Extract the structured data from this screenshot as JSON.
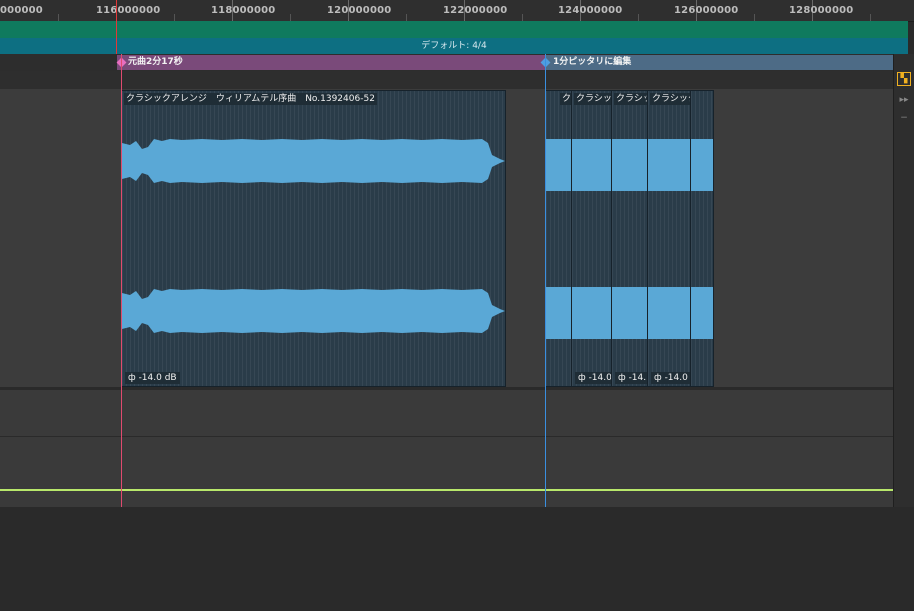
{
  "ruler": {
    "labels": [
      "000000",
      "116000000",
      "118000000",
      "120000000",
      "122000000",
      "124000000",
      "126000000",
      "128000000"
    ]
  },
  "tempo_lane": {
    "time_signature": "デフォルト: 4/4"
  },
  "markers": [
    {
      "label": "元曲2分17秒",
      "color": "#e86ec0"
    },
    {
      "label": "1分ピッタリに編集",
      "color": "#4f9ee0"
    }
  ],
  "clips": [
    {
      "title": "クラシックアレンジ　ウィリアムテル序曲　No.1392406-52",
      "gain": "-14.0 dB"
    },
    {
      "title": "ク",
      "gain": ""
    },
    {
      "title": "クラシック",
      "gain": "-14.0"
    },
    {
      "title": "クラシッ",
      "gain": "-14."
    },
    {
      "title": "クラシック",
      "gain": "-14.0"
    }
  ],
  "side_buttons": [
    "zoom-to-fit",
    "next",
    "minus"
  ],
  "colors": {
    "tempo_lane": "#0f7a5e",
    "time_sig_lane": "#0d6f82",
    "marker_a": "#7a4a7a",
    "marker_b": "#4d6b86",
    "waveform": "#5aa8d6",
    "clip_bg": "#2a3c49",
    "volume_line": "#b8e86b",
    "playhead_red": "#e04a6f",
    "playhead_blue": "#3a8fe0"
  }
}
